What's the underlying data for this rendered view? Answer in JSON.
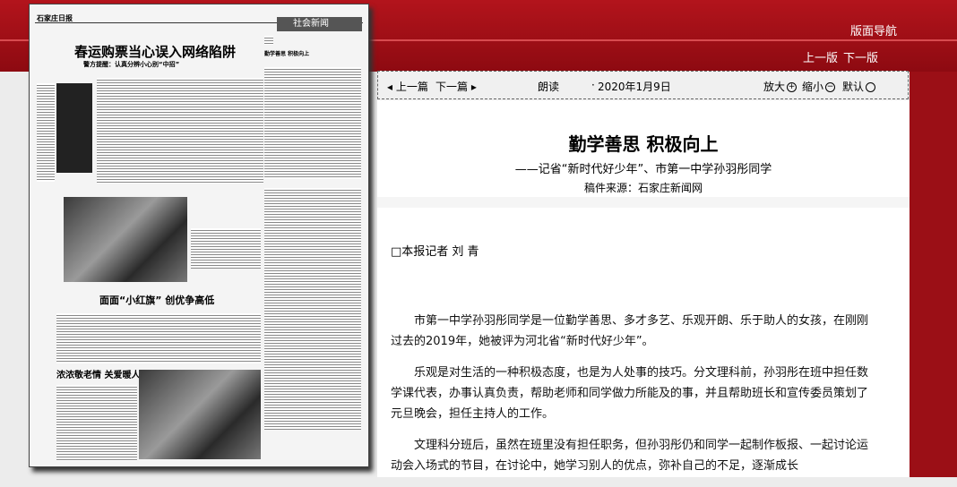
{
  "header": {
    "nav_title": "版面导航",
    "prev_page": "上一版",
    "next_page": "下一版"
  },
  "newspaper": {
    "logo": "石家庄日报",
    "section": "社会新闻",
    "headline": "春运购票当心误入网络陷阱",
    "subheadline": "警方提醒：认真分辨小心别“中招”",
    "headline2": "面面“小红旗” 创优争高低",
    "headline3": "浓浓敬老情 关爱暖人心",
    "sidebar_title": "勤学善思 积极向上"
  },
  "toolbar": {
    "prev_article": "上一篇",
    "next_article": "下一篇",
    "read_aloud": "朗读",
    "separator": "·",
    "date": "2020年1月9日",
    "zoom_in": "放大",
    "zoom_out": "缩小",
    "default": "默认"
  },
  "article": {
    "title": "勤学善思  积极向上",
    "subtitle": "——记省“新时代好少年”、市第一中学孙羽彤同学",
    "source": "稿件来源：石家庄新闻网",
    "byline": "□本报记者  刘  青",
    "paragraphs": [
      "市第一中学孙羽彤同学是一位勤学善思、多才多艺、乐观开朗、乐于助人的女孩，在刚刚过去的2019年，她被评为河北省“新时代好少年”。",
      "乐观是对生活的一种积极态度，也是为人处事的技巧。分文理科前，孙羽彤在班中担任数学课代表，办事认真负责，帮助老师和同学做力所能及的事，并且帮助班长和宣传委员策划了元旦晚会，担任主持人的工作。",
      "文理科分班后，虽然在班里没有担任职务，但孙羽彤仍和同学一起制作板报、一起讨论运动会入场式的节目，在讨论中，她学习别人的优点，弥补自己的不足，逐渐成长"
    ]
  }
}
